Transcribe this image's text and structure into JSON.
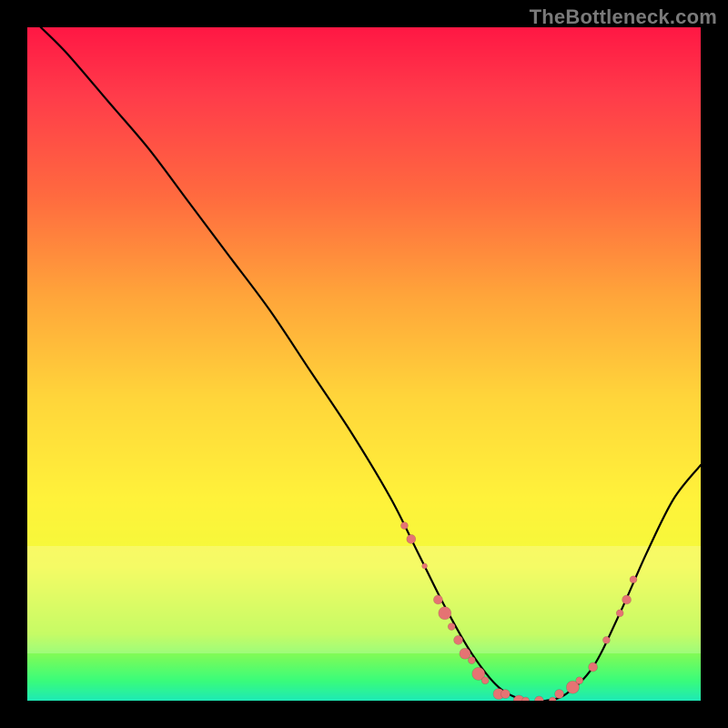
{
  "watermark": "TheBottleneck.com",
  "colors": {
    "gradient_top": "#ff1744",
    "gradient_mid": "#ffd53a",
    "gradient_bottom": "#1de9b6",
    "curve": "#000000",
    "dot": "#e57373",
    "background": "#000000",
    "watermark": "#7a7a7a"
  },
  "chart_data": {
    "type": "line",
    "title": "",
    "subtitle": "",
    "xlabel": "",
    "ylabel": "",
    "xlim": [
      0,
      100
    ],
    "ylim": [
      0,
      100
    ],
    "grid": false,
    "legend_position": "none",
    "series": [
      {
        "name": "curve",
        "x": [
          2,
          6,
          12,
          18,
          24,
          30,
          36,
          42,
          48,
          54,
          58,
          62,
          66,
          70,
          74,
          77,
          80,
          84,
          88,
          92,
          96,
          100
        ],
        "y": [
          100,
          96,
          89,
          82,
          74,
          66,
          58,
          49,
          40,
          30,
          22,
          14,
          7,
          2,
          0,
          0,
          1,
          5,
          13,
          22,
          30,
          35
        ]
      }
    ],
    "scatter": [
      {
        "x": 56,
        "y": 26,
        "r": 4
      },
      {
        "x": 57,
        "y": 24,
        "r": 5
      },
      {
        "x": 59,
        "y": 20,
        "r": 3
      },
      {
        "x": 61,
        "y": 15,
        "r": 5
      },
      {
        "x": 62,
        "y": 13,
        "r": 7
      },
      {
        "x": 63,
        "y": 11,
        "r": 4
      },
      {
        "x": 64,
        "y": 9,
        "r": 5
      },
      {
        "x": 65,
        "y": 7,
        "r": 6
      },
      {
        "x": 66,
        "y": 6,
        "r": 4
      },
      {
        "x": 67,
        "y": 4,
        "r": 7
      },
      {
        "x": 68,
        "y": 3,
        "r": 4
      },
      {
        "x": 70,
        "y": 1,
        "r": 6
      },
      {
        "x": 71,
        "y": 1,
        "r": 5
      },
      {
        "x": 73,
        "y": 0,
        "r": 6
      },
      {
        "x": 74,
        "y": 0,
        "r": 4
      },
      {
        "x": 76,
        "y": 0,
        "r": 5
      },
      {
        "x": 78,
        "y": 0,
        "r": 4
      },
      {
        "x": 79,
        "y": 1,
        "r": 5
      },
      {
        "x": 81,
        "y": 2,
        "r": 7
      },
      {
        "x": 82,
        "y": 3,
        "r": 4
      },
      {
        "x": 84,
        "y": 5,
        "r": 5
      },
      {
        "x": 86,
        "y": 9,
        "r": 4
      },
      {
        "x": 88,
        "y": 13,
        "r": 4
      },
      {
        "x": 89,
        "y": 15,
        "r": 5
      },
      {
        "x": 90,
        "y": 18,
        "r": 4
      }
    ]
  }
}
